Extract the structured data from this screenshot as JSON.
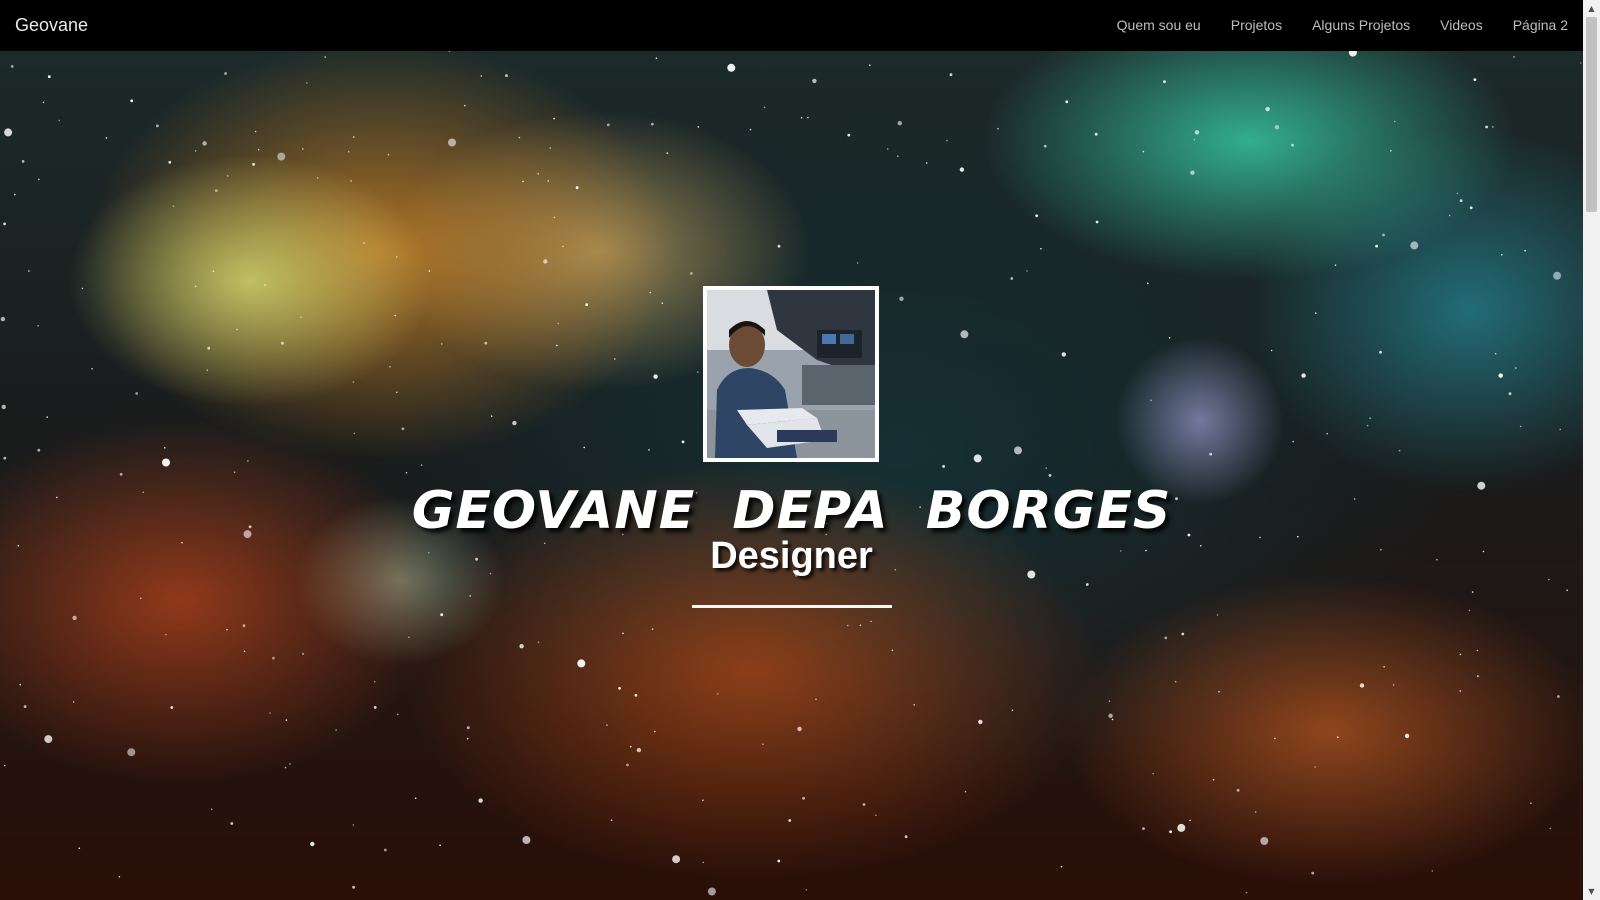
{
  "navbar": {
    "brand": "Geovane",
    "links": [
      {
        "label": "Quem sou eu"
      },
      {
        "label": "Projetos"
      },
      {
        "label": "Alguns Projetos"
      },
      {
        "label": "Videos"
      },
      {
        "label": "Página 2"
      }
    ]
  },
  "hero": {
    "name": "GEOVANE DEPA BORGES",
    "role": "Designer"
  },
  "colors": {
    "navbar_bg": "#000000",
    "nav_text": "#bdbdbd",
    "hero_text": "#ffffff"
  },
  "icons": [
    "chevron-up-icon",
    "chevron-down-icon"
  ]
}
